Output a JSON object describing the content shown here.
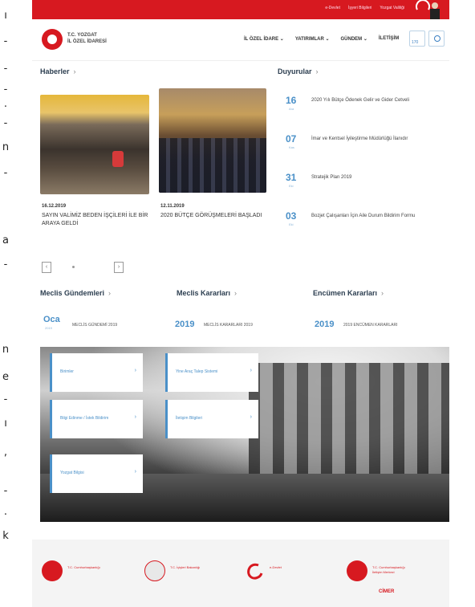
{
  "edge_chars": [
    "ı",
    "-",
    "-",
    "-",
    ".",
    "-",
    "n",
    "-",
    "a",
    "-",
    "n",
    "e",
    "-",
    "ı",
    ",",
    "-",
    ".",
    "k"
  ],
  "topbar": {
    "links": [
      "e-Devlet",
      "İşyeri Bilgileri",
      "Yozgat Valiliği"
    ]
  },
  "header": {
    "logo_line1": "T.C. YOZGAT",
    "logo_line2": "İL ÖZEL İDARESİ",
    "nav": [
      "İL ÖZEL İDARE ⌄",
      "YATIRIMLAR ⌄",
      "GÜNDEM ⌄",
      "İLETİŞİM"
    ],
    "btn_label": "170"
  },
  "news": {
    "title": "Haberler",
    "items": [
      {
        "date": "16.12.2019",
        "title": "SAYIN VALİMİZ BEDEN İŞÇİLERİ İLE BİR ARAYA GELDİ"
      },
      {
        "date": "12.11.2019",
        "title": "2020 BÜTÇE GÖRÜŞMELERİ BAŞLADI"
      }
    ],
    "prev": "‹",
    "next": "›"
  },
  "announcements": {
    "title": "Duyurular",
    "items": [
      {
        "day": "16",
        "month": "Ara",
        "text": "2020 Yılı Bütçe Ödenek Gelir ve Gider Cetveli"
      },
      {
        "day": "07",
        "month": "Kas",
        "text": "İmar ve Kentsel İyileştirme Müdürlüğü İlanıdır"
      },
      {
        "day": "31",
        "month": "Eki",
        "text": "Stratejik Plan 2019"
      },
      {
        "day": "03",
        "month": "Eki",
        "text": "Bozjet Çalışanları İçin Aile Durum Bildirim Formu"
      }
    ]
  },
  "meclis": [
    {
      "title": "Meclis Gündemleri",
      "num": "Oca",
      "sub": "2019",
      "text": "MECLİS GÜNDEMİ 2019"
    },
    {
      "title": "Meclis Kararları",
      "num": "2019",
      "text": "MECLİS KARARLARI 2019"
    },
    {
      "title": "Encümen Kararları",
      "num": "2019",
      "text": "2019 ENCÜMEN KARARLARI"
    }
  ],
  "tiles": [
    {
      "label": "Birimler",
      "arrow": "›"
    },
    {
      "label": "Yine Araç Talep Sistemi",
      "arrow": "›"
    },
    {
      "label": "Bilgi Edinme / İstek Bildirim",
      "arrow": "›"
    },
    {
      "label": "İletişim Bilgileri",
      "arrow": "›"
    },
    {
      "label": "Yozgat Bilgisi",
      "arrow": "›"
    }
  ],
  "footer": {
    "logos": [
      {
        "label": "T.C. Cumhurbaşkanlığı"
      },
      {
        "label": "T.C. İçişleri Bakanlığı"
      },
      {
        "label": "e-Devlet"
      },
      {
        "label": "T.C. Cumhurbaşkanlığı İletişim Merkezi"
      }
    ],
    "cimer": "CİMER"
  },
  "colors": {
    "brand_red": "#d71920",
    "accent_blue": "#4a90c8"
  }
}
